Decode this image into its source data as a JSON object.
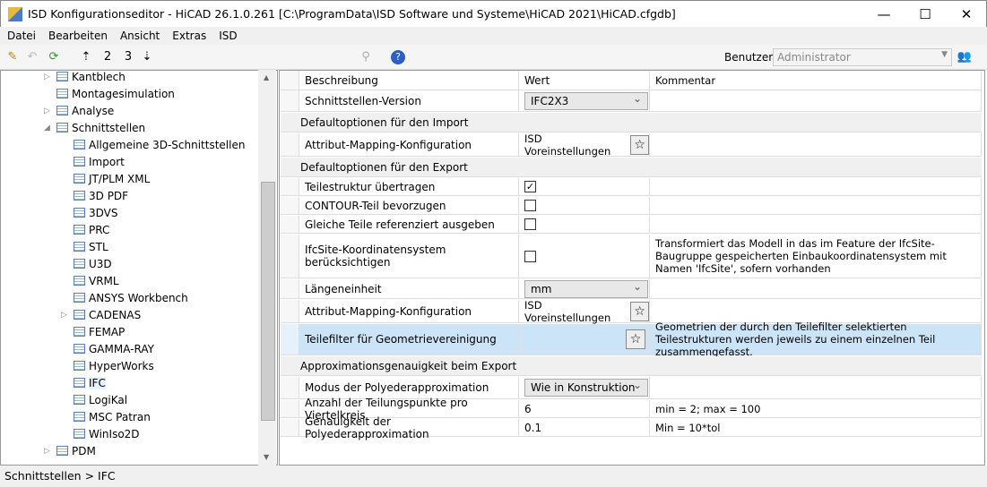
{
  "window": {
    "title": "ISD Konfigurationseditor  - HiCAD 26.1.0.261 [C:\\ProgramData\\ISD Software und Systeme\\HiCAD 2021\\HiCAD.cfgdb]",
    "min": "—",
    "max": "☐",
    "close": "✕"
  },
  "menu": [
    "Datei",
    "Bearbeiten",
    "Ansicht",
    "Extras",
    "ISD"
  ],
  "toolbar": {
    "user_label": "Benutzer",
    "user_value": "Administrator",
    "level2": "2",
    "level3": "3"
  },
  "tree": [
    {
      "label": "Kantblech",
      "level": 1,
      "arrow": "▷"
    },
    {
      "label": "Montagesimulation",
      "level": 1
    },
    {
      "label": "Analyse",
      "level": 1,
      "arrow": "▷"
    },
    {
      "label": "Schnittstellen",
      "level": 1,
      "arrow": "◢"
    },
    {
      "label": "Allgemeine 3D-Schnittstellen",
      "level": 2
    },
    {
      "label": "Import",
      "level": 2
    },
    {
      "label": "JT/PLM XML",
      "level": 2
    },
    {
      "label": "3D PDF",
      "level": 2
    },
    {
      "label": "3DVS",
      "level": 2
    },
    {
      "label": "PRC",
      "level": 2
    },
    {
      "label": "STL",
      "level": 2
    },
    {
      "label": "U3D",
      "level": 2
    },
    {
      "label": "VRML",
      "level": 2
    },
    {
      "label": "ANSYS Workbench",
      "level": 2
    },
    {
      "label": "CADENAS",
      "level": 2,
      "arrow": "▷"
    },
    {
      "label": "FEMAP",
      "level": 2
    },
    {
      "label": "GAMMA-RAY",
      "level": 2
    },
    {
      "label": "HyperWorks",
      "level": 2
    },
    {
      "label": "IFC",
      "level": 2,
      "selected": true
    },
    {
      "label": "LogiKal",
      "level": 2
    },
    {
      "label": "MSC Patran",
      "level": 2
    },
    {
      "label": "WinIso2D",
      "level": 2
    },
    {
      "label": "PDM",
      "level": 1,
      "arrow": "▷"
    }
  ],
  "grid": {
    "headers": [
      "Beschreibung",
      "Wert",
      "Kommentar"
    ],
    "rows": [
      {
        "type": "row",
        "desc": "Schnittstellen-Version",
        "value": "IFC2X3",
        "kind": "dropdown",
        "comment": ""
      },
      {
        "type": "section",
        "desc": "Defaultoptionen für den Import"
      },
      {
        "type": "row",
        "desc": "Attribut-Mapping-Konfiguration",
        "value": "ISD Voreinstellungen",
        "kind": "star",
        "comment": ""
      },
      {
        "type": "section",
        "desc": "Defaultoptionen für den Export"
      },
      {
        "type": "row",
        "desc": "Teilestruktur übertragen",
        "value": "✓",
        "kind": "check",
        "comment": ""
      },
      {
        "type": "row",
        "desc": "CONTOUR-Teil bevorzugen",
        "value": "",
        "kind": "check",
        "comment": ""
      },
      {
        "type": "row",
        "desc": "Gleiche Teile referenziert ausgeben",
        "value": "",
        "kind": "check",
        "comment": ""
      },
      {
        "type": "row",
        "desc": "IfcSite-Koordinatensystem berücksichtigen",
        "value": "",
        "kind": "check",
        "comment": "Transformiert das Modell in das im Feature der IfcSite-Baugruppe gespeicherten Einbaukoordinatensystem mit Namen 'IfcSite', sofern vorhanden"
      },
      {
        "type": "row",
        "desc": "Längeneinheit",
        "value": "mm",
        "kind": "dropdown",
        "comment": ""
      },
      {
        "type": "row",
        "desc": "Attribut-Mapping-Konfiguration",
        "value": "ISD Voreinstellungen",
        "kind": "star",
        "comment": ""
      },
      {
        "type": "row",
        "desc": "Teilefilter für Geometrievereinigung",
        "value": "",
        "kind": "star",
        "comment": "Geometrien der durch den Teilefilter selektierten Teilestrukturen werden jeweils zu einem einzelnen Teil zusammengefasst.",
        "selected": true
      },
      {
        "type": "section",
        "desc": "Approximationsgenauigkeit beim Export"
      },
      {
        "type": "row",
        "desc": "Modus der Polyederapproximation",
        "value": "Wie in Konstruktion",
        "kind": "dropdown",
        "comment": ""
      },
      {
        "type": "row",
        "desc": "Anzahl der Teilungspunkte pro Viertelkreis",
        "value": "6",
        "kind": "text",
        "comment": "min = 2; max = 100"
      },
      {
        "type": "row",
        "desc": "Genauigkeit der Polyederapproximation",
        "value": "0.1",
        "kind": "text",
        "comment": "Min = 10*tol"
      }
    ]
  },
  "status": "Schnittstellen > IFC"
}
